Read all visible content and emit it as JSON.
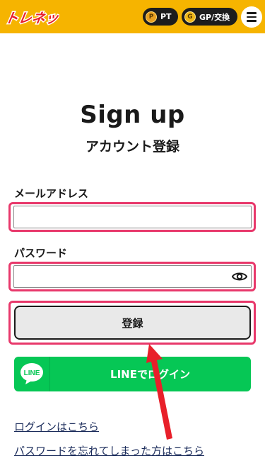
{
  "header": {
    "logo_text": "トレネット",
    "pt_label": "PT",
    "gp_label": "GP/交換",
    "accent_color": "#f6b400"
  },
  "titles": {
    "en": "Sign up",
    "jp": "アカウント登録"
  },
  "form": {
    "email_label": "メールアドレス",
    "email_value": "",
    "password_label": "パスワード",
    "password_value": "",
    "submit_label": "登録"
  },
  "line_login": {
    "icon_text": "LINE",
    "label": "LINEでログイン",
    "color": "#06c755"
  },
  "links": {
    "login": "ログインはこちら",
    "forgot_password": "パスワードを忘れてしまった方はこちら"
  },
  "annotation": {
    "highlight_color": "#e8386b",
    "arrow_color": "#e8202a"
  }
}
